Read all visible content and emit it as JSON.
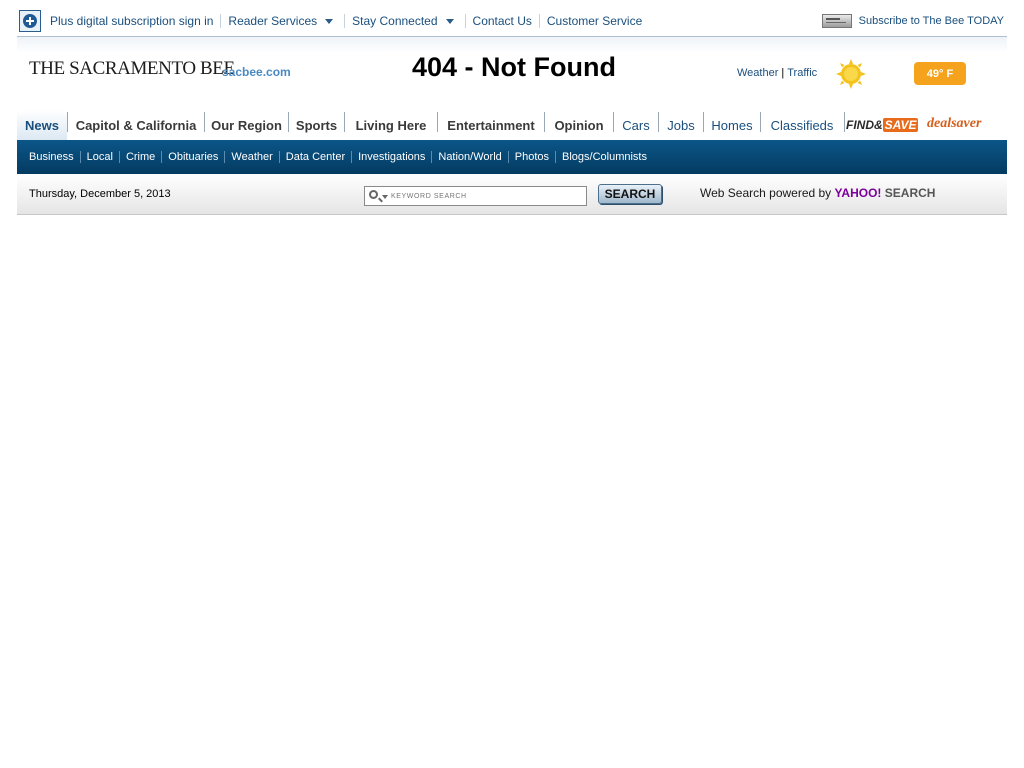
{
  "topbar": {
    "plus_link": "Plus digital subscription sign in",
    "reader_services": "Reader Services",
    "stay_connected": "Stay Connected",
    "contact_us": "Contact Us",
    "customer_service": "Customer Service",
    "subscribe": "Subscribe to The Bee TODAY"
  },
  "masthead": {
    "logo_text": "THE SACRAMENTO BEE",
    "site": "sacbee.com",
    "page_title": "404 - Not Found",
    "weather_link": "Weather",
    "separator": "|",
    "traffic_link": "Traffic",
    "temperature": "49° F"
  },
  "mainnav": {
    "items": [
      {
        "label": "News"
      },
      {
        "label": "Capitol & California"
      },
      {
        "label": "Our Region"
      },
      {
        "label": "Sports"
      },
      {
        "label": "Living Here"
      },
      {
        "label": "Entertainment"
      },
      {
        "label": "Opinion"
      },
      {
        "label": "Cars"
      },
      {
        "label": "Jobs"
      },
      {
        "label": "Homes"
      },
      {
        "label": "Classifieds"
      }
    ],
    "findsave_find": "FIND&",
    "findsave_save": "SAVE",
    "dealsaver": "dealsaver"
  },
  "subnav": {
    "items": [
      "Business",
      "Local",
      "Crime",
      "Obituaries",
      "Weather",
      "Data Center",
      "Investigations",
      "Nation/World",
      "Photos",
      "Blogs/Columnists"
    ]
  },
  "datebar": {
    "date": "Thursday, December 5, 2013",
    "search_placeholder": "KEYWORD SEARCH",
    "search_button": "SEARCH",
    "websearch_prefix": "Web Search powered by",
    "websearch_yahoo": "YAHOO!",
    "websearch_suffix": "SEARCH"
  },
  "colors": {
    "link_blue": "#1a4f7e",
    "subnav_blue": "#0b5688",
    "temp_orange": "#f5a21c"
  }
}
